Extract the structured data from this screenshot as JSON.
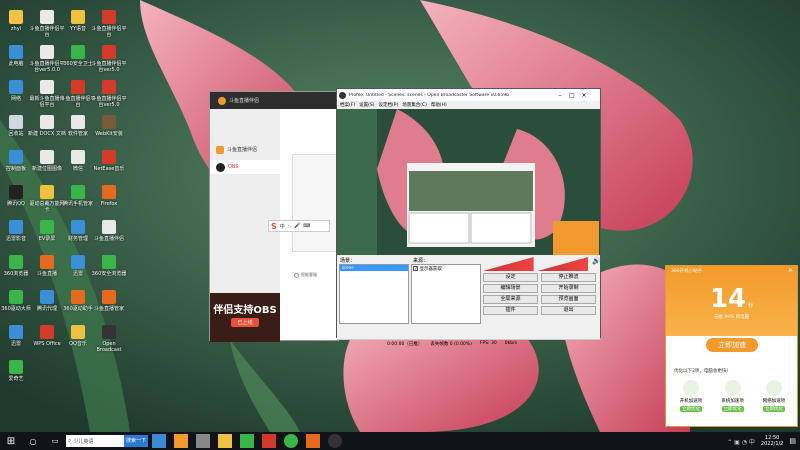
{
  "desktop": {
    "icons": [
      {
        "label": "zhyi",
        "color": "#f5c244"
      },
      {
        "label": "斗鱼直播伴侣平台",
        "color": "#e9e9e9"
      },
      {
        "label": "YY语音",
        "color": "#f0c040"
      },
      {
        "label": "斗鱼直播伴侣平台",
        "color": "#d43a2a"
      },
      {
        "label": "此电脑",
        "color": "#3b8fd6"
      },
      {
        "label": "斗鱼直播伴侣平台ver5.0.0",
        "color": "#e9e9e9"
      },
      {
        "label": "360安全卫士",
        "color": "#3ab54a"
      },
      {
        "label": "斗鱼直播伴侣平台ver5.0",
        "color": "#d43a2a"
      },
      {
        "label": "网络",
        "color": "#3b8fd6"
      },
      {
        "label": "最新斗鱼直播伴侣平台",
        "color": "#e9e9e9"
      },
      {
        "label": "斗鱼直播伴侣平台",
        "color": "#d43a2a"
      },
      {
        "label": "斗鱼直播伴侣平台ver5.0",
        "color": "#d43a2a"
      },
      {
        "label": "回收站",
        "color": "#cfd8e0"
      },
      {
        "label": "新建 DOCX 文档",
        "color": "#e9e9e9"
      },
      {
        "label": "软件管家",
        "color": "#e9e9e9"
      },
      {
        "label": "WebKit安装",
        "color": "#7a5a3a"
      },
      {
        "label": "控制面板",
        "color": "#3b8fd6"
      },
      {
        "label": "新建位图图像",
        "color": "#e9e9e9"
      },
      {
        "label": "微信",
        "color": "#e9e9e9"
      },
      {
        "label": "NetEase音乐",
        "color": "#d43a2a"
      },
      {
        "label": "腾讯QQ",
        "color": "#222"
      },
      {
        "label": "驱动总裁万能网卡",
        "color": "#f0c040"
      },
      {
        "label": "腾讯手机管家",
        "color": "#3ab54a"
      },
      {
        "label": "Firefox",
        "color": "#e66a1e"
      },
      {
        "label": "迅雷影音",
        "color": "#3b8fd6"
      },
      {
        "label": "EV录屏",
        "color": "#3ab54a"
      },
      {
        "label": "财务管理",
        "color": "#3b8fd6"
      },
      {
        "label": "斗鱼直播伴侣",
        "color": "#e9e9e9"
      },
      {
        "label": "360浏览器",
        "color": "#3ab54a"
      },
      {
        "label": "斗鱼直播",
        "color": "#e66a1e"
      },
      {
        "label": "迅雷",
        "color": "#3b8fd6"
      },
      {
        "label": "360安全浏览器",
        "color": "#3ab54a"
      },
      {
        "label": "360驱动大师",
        "color": "#3ab54a"
      },
      {
        "label": "腾讯代理",
        "color": "#3b8fd6"
      },
      {
        "label": "360驱动助手",
        "color": "#e66a1e"
      },
      {
        "label": "斗鱼直播管家",
        "color": "#e66a1e"
      },
      {
        "label": "迅雷",
        "color": "#3b8fd6"
      },
      {
        "label": "WPS Office",
        "color": "#d43a2a"
      },
      {
        "label": "QQ音乐",
        "color": "#f0c040"
      },
      {
        "label": "Open Broadcast",
        "color": "#333"
      },
      {
        "label": "爱奇艺",
        "color": "#3ab54a"
      }
    ]
  },
  "douyu": {
    "title": "斗鱼直播伴侣",
    "nav1": "斗鱼直播伴侣",
    "nav2": "OBS",
    "banner_big": "伴侣支持OBS",
    "banner_btn": "已上线",
    "footer": "智能客服"
  },
  "obs": {
    "title": "Profile: Untitled - Scenes: scenes - Open Broadcaster Software v0.659b",
    "menus": [
      "档案(F)",
      "设置(S)",
      "设定档(P)",
      "场景集合(C)",
      "帮助(H)"
    ],
    "scenes_label": "场景：",
    "sources_label": "来源：",
    "source_item": "显示器获取",
    "scene_item": "scene",
    "buttons": [
      [
        "设定",
        "停止推流"
      ],
      [
        "编辑场景",
        "开始录制"
      ],
      [
        "全局来源",
        "预览画面"
      ],
      [
        "插件",
        "退出"
      ]
    ],
    "status_time": "0:00:00（已推）",
    "status_frames": "丢失帧数  0 (0.00%)",
    "status_fps": "FPS: 30",
    "status_kbps": "0kb/s"
  },
  "popup": {
    "title": "360开机小助手",
    "value": "14",
    "unit": "秒",
    "desc": "击败 99% 的电脑",
    "btn": "立即加速",
    "tip": "优化以下3项，电脑会更快！",
    "items": [
      "开机加速项",
      "系统加速项",
      "网络加速项"
    ],
    "subbtn": "立即优化"
  },
  "taskbar": {
    "search": "少儿英语",
    "search_btn": "搜索一下",
    "time": "12:50",
    "date": "2022/1/2"
  }
}
